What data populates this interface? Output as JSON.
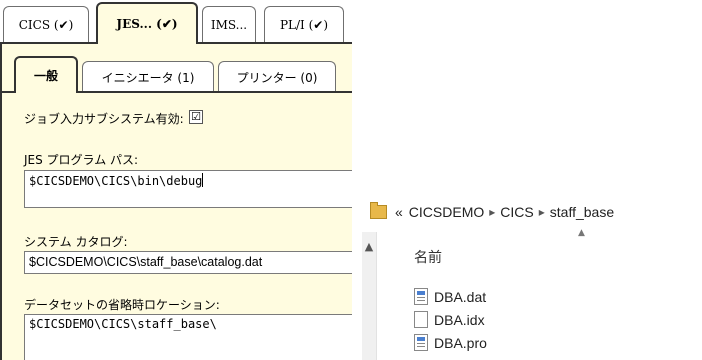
{
  "settings": {
    "outer_tabs": [
      "CICS (✔)",
      "JES... (✔)",
      "IMS...",
      "PL/I (✔)"
    ],
    "inner_tabs": [
      "一般",
      "イニシエータ (1)",
      "プリンター (0)"
    ],
    "enable_label": "ジョブ入力サブシステム有効:",
    "enable_checked": "☑",
    "program_path_label": "JES プログラム パス:",
    "program_path_value": "$CICSDEMO\\CICS\\bin\\debug",
    "catalog_label": "システム カタログ:",
    "catalog_value": "$CICSDEMO\\CICS\\staff_base\\catalog.dat",
    "dataset_label": "データセットの省略時ロケーション:",
    "dataset_value": "$CICSDEMO\\CICS\\staff_base\\"
  },
  "explorer": {
    "breadcrumb_prefix": "«",
    "breadcrumb": [
      "CICSDEMO",
      "CICS",
      "staff_base"
    ],
    "breadcrumb_sep": "▸",
    "column_name": "名前",
    "files": [
      {
        "name": "DBA.dat",
        "icon": "app-file-icon"
      },
      {
        "name": "DBA.idx",
        "icon": "blank-file-icon"
      },
      {
        "name": "DBA.pro",
        "icon": "app-file-icon"
      }
    ]
  }
}
